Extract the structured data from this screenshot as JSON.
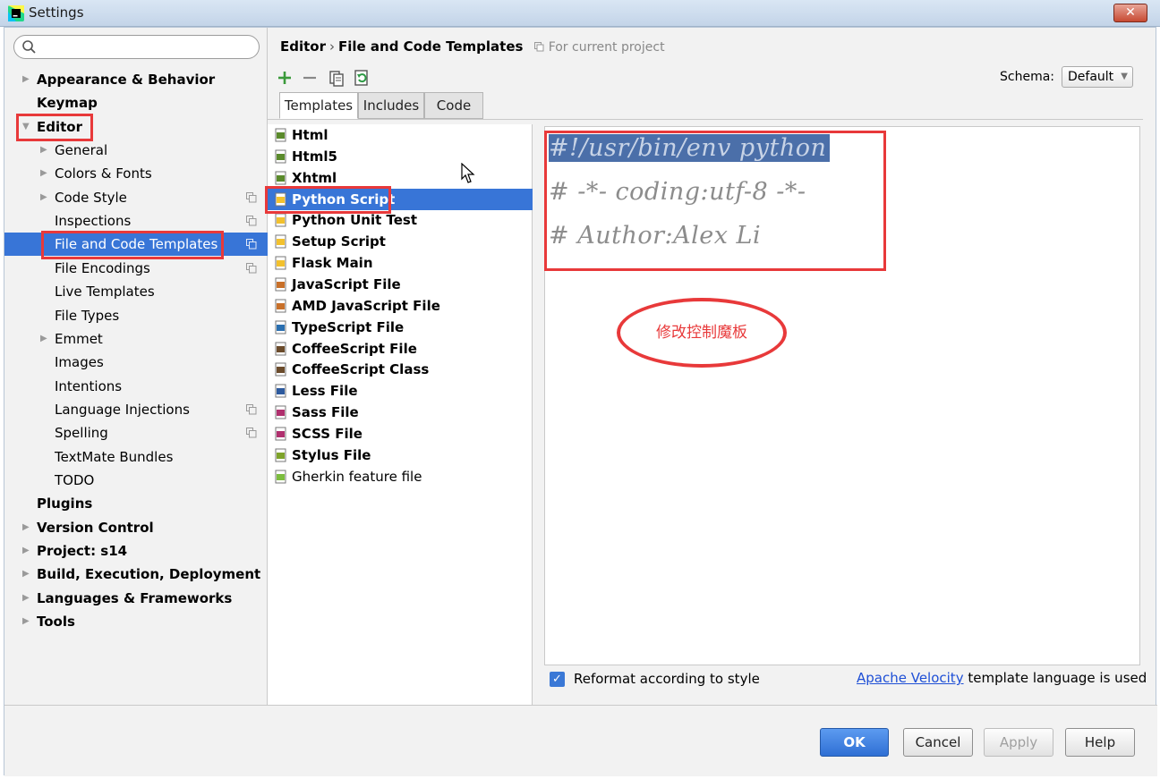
{
  "window": {
    "title": "Settings",
    "close": "✕"
  },
  "search": {
    "placeholder": ""
  },
  "tree": [
    {
      "label": "Appearance & Behavior",
      "level": 0,
      "arrow": "▶",
      "bold": true,
      "project": false,
      "selected": false,
      "boxed": false
    },
    {
      "label": "Keymap",
      "level": 0,
      "arrow": "",
      "bold": true,
      "project": false,
      "selected": false,
      "boxed": false
    },
    {
      "label": "Editor",
      "level": 0,
      "arrow": "▼",
      "bold": true,
      "project": false,
      "selected": false,
      "boxed": true
    },
    {
      "label": "General",
      "level": 1,
      "arrow": "▶",
      "bold": false,
      "project": false,
      "selected": false,
      "boxed": false
    },
    {
      "label": "Colors & Fonts",
      "level": 1,
      "arrow": "▶",
      "bold": false,
      "project": false,
      "selected": false,
      "boxed": false
    },
    {
      "label": "Code Style",
      "level": 1,
      "arrow": "▶",
      "bold": false,
      "project": true,
      "selected": false,
      "boxed": false
    },
    {
      "label": "Inspections",
      "level": 1,
      "arrow": "",
      "bold": false,
      "project": true,
      "selected": false,
      "boxed": false
    },
    {
      "label": "File and Code Templates",
      "level": 1,
      "arrow": "",
      "bold": false,
      "project": true,
      "selected": true,
      "boxed": true
    },
    {
      "label": "File Encodings",
      "level": 1,
      "arrow": "",
      "bold": false,
      "project": true,
      "selected": false,
      "boxed": false
    },
    {
      "label": "Live Templates",
      "level": 1,
      "arrow": "",
      "bold": false,
      "project": false,
      "selected": false,
      "boxed": false
    },
    {
      "label": "File Types",
      "level": 1,
      "arrow": "",
      "bold": false,
      "project": false,
      "selected": false,
      "boxed": false
    },
    {
      "label": "Emmet",
      "level": 1,
      "arrow": "▶",
      "bold": false,
      "project": false,
      "selected": false,
      "boxed": false
    },
    {
      "label": "Images",
      "level": 1,
      "arrow": "",
      "bold": false,
      "project": false,
      "selected": false,
      "boxed": false
    },
    {
      "label": "Intentions",
      "level": 1,
      "arrow": "",
      "bold": false,
      "project": false,
      "selected": false,
      "boxed": false
    },
    {
      "label": "Language Injections",
      "level": 1,
      "arrow": "",
      "bold": false,
      "project": true,
      "selected": false,
      "boxed": false
    },
    {
      "label": "Spelling",
      "level": 1,
      "arrow": "",
      "bold": false,
      "project": true,
      "selected": false,
      "boxed": false
    },
    {
      "label": "TextMate Bundles",
      "level": 1,
      "arrow": "",
      "bold": false,
      "project": false,
      "selected": false,
      "boxed": false
    },
    {
      "label": "TODO",
      "level": 1,
      "arrow": "",
      "bold": false,
      "project": false,
      "selected": false,
      "boxed": false
    },
    {
      "label": "Plugins",
      "level": 0,
      "arrow": "",
      "bold": true,
      "project": false,
      "selected": false,
      "boxed": false
    },
    {
      "label": "Version Control",
      "level": 0,
      "arrow": "▶",
      "bold": true,
      "project": false,
      "selected": false,
      "boxed": false
    },
    {
      "label": "Project: s14",
      "level": 0,
      "arrow": "▶",
      "bold": true,
      "project": false,
      "selected": false,
      "boxed": false
    },
    {
      "label": "Build, Execution, Deployment",
      "level": 0,
      "arrow": "▶",
      "bold": true,
      "project": false,
      "selected": false,
      "boxed": false
    },
    {
      "label": "Languages & Frameworks",
      "level": 0,
      "arrow": "▶",
      "bold": true,
      "project": false,
      "selected": false,
      "boxed": false
    },
    {
      "label": "Tools",
      "level": 0,
      "arrow": "▶",
      "bold": true,
      "project": false,
      "selected": false,
      "boxed": false
    }
  ],
  "breadcrumb": {
    "parent": "Editor",
    "separator": "›",
    "current": "File and Code Templates",
    "scope_note": "For current project"
  },
  "schema": {
    "label": "Schema:",
    "value": "Default",
    "arrow": "▼"
  },
  "tabs": [
    "Templates",
    "Includes",
    "Code"
  ],
  "templates": [
    {
      "label": "Html",
      "icon": "html-icon",
      "color": "#5a8a2b",
      "selected": false,
      "bold": true
    },
    {
      "label": "Html5",
      "icon": "html5-icon",
      "color": "#5a8a2b",
      "selected": false,
      "bold": true
    },
    {
      "label": "Xhtml",
      "icon": "xhtml-icon",
      "color": "#5a8a2b",
      "selected": false,
      "bold": true
    },
    {
      "label": "Python Script",
      "icon": "python-icon",
      "color": "#f2c12e",
      "selected": true,
      "bold": true
    },
    {
      "label": "Python Unit Test",
      "icon": "python-icon",
      "color": "#f2c12e",
      "selected": false,
      "bold": true
    },
    {
      "label": "Setup Script",
      "icon": "python-icon",
      "color": "#f2c12e",
      "selected": false,
      "bold": true
    },
    {
      "label": "Flask Main",
      "icon": "python-icon",
      "color": "#f2c12e",
      "selected": false,
      "bold": true
    },
    {
      "label": "JavaScript File",
      "icon": "javascript-icon",
      "color": "#c8702a",
      "selected": false,
      "bold": true
    },
    {
      "label": "AMD JavaScript File",
      "icon": "javascript-icon",
      "color": "#c8702a",
      "selected": false,
      "bold": true
    },
    {
      "label": "TypeScript File",
      "icon": "typescript-icon",
      "color": "#2a6fb0",
      "selected": false,
      "bold": true
    },
    {
      "label": "CoffeeScript File",
      "icon": "coffeescript-icon",
      "color": "#6b4b2b",
      "selected": false,
      "bold": true
    },
    {
      "label": "CoffeeScript Class",
      "icon": "coffeescript-icon",
      "color": "#6b4b2b",
      "selected": false,
      "bold": true
    },
    {
      "label": "Less File",
      "icon": "less-icon",
      "color": "#2d5a9e",
      "selected": false,
      "bold": true
    },
    {
      "label": "Sass File",
      "icon": "sass-icon",
      "color": "#b0306e",
      "selected": false,
      "bold": true
    },
    {
      "label": "SCSS File",
      "icon": "scss-icon",
      "color": "#b0306e",
      "selected": false,
      "bold": true
    },
    {
      "label": "Stylus File",
      "icon": "stylus-icon",
      "color": "#7ea32a",
      "selected": false,
      "bold": true
    },
    {
      "label": "Gherkin feature file",
      "icon": "gherkin-icon",
      "color": "#7cbd3e",
      "selected": false,
      "bold": false
    }
  ],
  "editor": {
    "lines": [
      "#!/usr/bin/env python",
      "# -*- coding:utf-8 -*-",
      "# Author:Alex Li"
    ]
  },
  "annotation": {
    "text": "修改控制魔板"
  },
  "footer": {
    "reformat_label": "Reformat according to style",
    "reformat_checked": true,
    "velocity_link": "Apache Velocity",
    "velocity_suffix": " template language is used"
  },
  "buttons": {
    "ok": "OK",
    "cancel": "Cancel",
    "apply": "Apply",
    "help": "Help"
  },
  "colors": {
    "selection": "#3875d7",
    "annotation_red": "#e8393a",
    "code_highlight": "#4b6fa9"
  }
}
